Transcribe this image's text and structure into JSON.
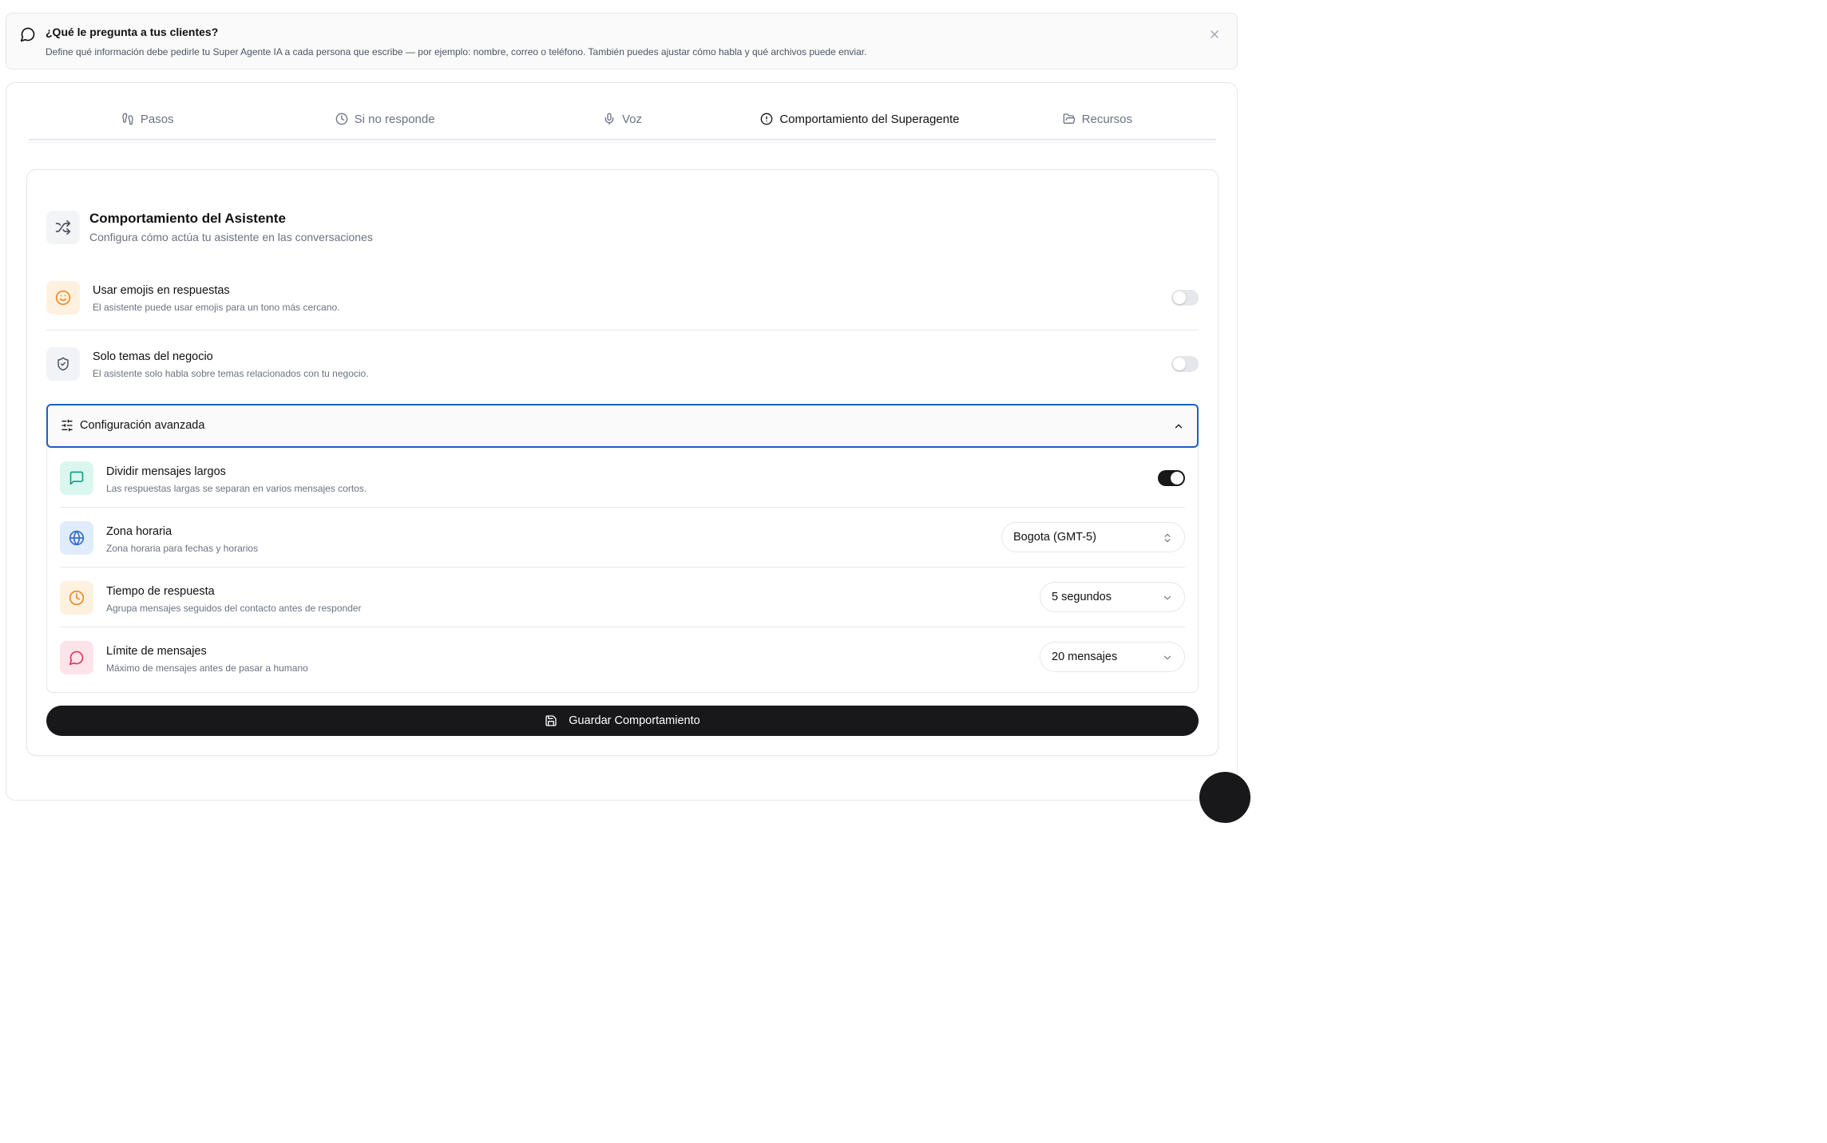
{
  "banner": {
    "title": "¿Qué le pregunta a tus clientes?",
    "text": "Define qué información debe pedirle tu Super Agente IA a cada persona que escribe — por ejemplo: nombre, correo o teléfono. También puedes ajustar cómo habla y qué archivos puede enviar.",
    "icon": "message-circle-icon",
    "close_icon": "close-icon"
  },
  "tabs": [
    {
      "label": "Pasos",
      "icon": "footprints-icon",
      "active": false
    },
    {
      "label": "Si no responde",
      "icon": "clock-icon",
      "active": false
    },
    {
      "label": "Voz",
      "icon": "mic-icon",
      "active": false
    },
    {
      "label": "Comportamiento del Superagente",
      "icon": "alert-circle-icon",
      "active": true
    },
    {
      "label": "Recursos",
      "icon": "folder-icon",
      "active": false
    }
  ],
  "card": {
    "title": "Comportamiento del Asistente",
    "subtitle": "Configura cómo actúa tu asistente en las conversaciones",
    "icon": "shuffle-icon"
  },
  "settings": [
    {
      "title": "Usar emojis en respuestas",
      "description": "El asistente puede usar emojis para un tono más cercano.",
      "icon": "smile-icon",
      "enabled": false
    },
    {
      "title": "Solo temas del negocio",
      "description": "El asistente solo habla sobre temas relacionados con tu negocio.",
      "icon": "shield-check-icon",
      "enabled": false
    }
  ],
  "advanced": {
    "label": "Configuración avanzada",
    "expanded": true,
    "rows": [
      {
        "title": "Dividir mensajes largos",
        "description": "Las respuestas largas se separan en varios mensajes cortos.",
        "icon": "message-square-icon",
        "enabled": true
      },
      {
        "title": "Zona horaria",
        "description": "Zona horaria para fechas y horarios",
        "icon": "globe-icon",
        "value": "Bogota (GMT-5)"
      },
      {
        "title": "Tiempo de respuesta",
        "description": "Agrupa mensajes seguidos del contacto antes de responder",
        "icon": "clock-icon",
        "value": "5 segundos"
      },
      {
        "title": "Límite de mensajes",
        "description": "Máximo de mensajes antes de pasar a humano",
        "icon": "message-circle-icon",
        "value": "20 mensajes"
      }
    ]
  },
  "save_button": {
    "label": "Guardar Comportamiento",
    "icon": "save-icon"
  },
  "colors": {
    "accent_dark": "#18181b",
    "focus_blue": "#1d5fbf",
    "emoji_bg": "#fff1e0",
    "emoji_fg": "#f08a24",
    "shield_bg": "#f1f3f6",
    "shield_fg": "#4b5563",
    "split_bg": "#d9f7ef",
    "split_fg": "#14a085",
    "globe_bg": "#e0ecfb",
    "globe_fg": "#2f6fd6",
    "time_bg": "#fff1e0",
    "time_fg": "#f08a24",
    "limit_bg": "#fde4ea",
    "limit_fg": "#e3355b"
  }
}
